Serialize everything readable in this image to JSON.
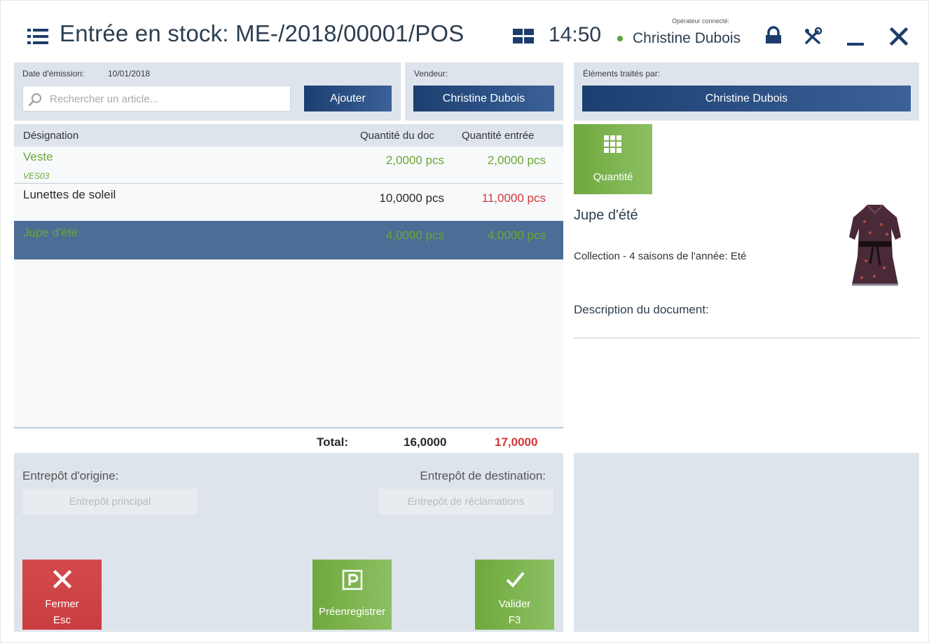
{
  "header": {
    "title": "Entrée en stock: ME-/2018/00001/POS",
    "time": "14:50",
    "operator_label": "Opérateur connecté:",
    "operator_name": "Christine Dubois"
  },
  "document": {
    "issue_date_label": "Date d'émission:",
    "issue_date": "10/01/2018",
    "search_placeholder": "Rechercher un article...",
    "add_label": "Ajouter",
    "seller_label": "Vendeur:",
    "seller_name": "Christine Dubois",
    "handled_by_label": "Éléments traités par:",
    "handled_by_name": "Christine Dubois"
  },
  "table": {
    "headers": [
      "Désignation",
      "Quantité du doc",
      "Quantité entrée"
    ],
    "rows": [
      {
        "name": "Veste",
        "code": "VES03",
        "qty_doc": "2,0000 pcs",
        "qty_in": "2,0000 pcs",
        "selected": false
      },
      {
        "name": "Lunettes de soleil",
        "code": "",
        "qty_doc": "10,0000 pcs",
        "qty_in": "11,0000 pcs",
        "selected": false
      },
      {
        "name": "Jupe d'été",
        "code": "",
        "qty_doc": "4,0000 pcs",
        "qty_in": "4,0000 pcs",
        "selected": true
      }
    ],
    "total_label": "Total:",
    "total_doc": "16,0000",
    "total_in": "17,0000"
  },
  "warehouses": {
    "origin_label": "Entrepôt d'origine:",
    "origin_value": "Entrepôt principal",
    "dest_label": "Entrepôt de destination:",
    "dest_value": "Entrepôt de réclamations"
  },
  "actions": {
    "close_label": "Fermer",
    "close_key": "Esc",
    "preregister_label": "Préenregistrer",
    "validate_label": "Valider",
    "validate_key": "F3"
  },
  "details": {
    "quantity_button": "Quantité",
    "product_name": "Jupe d'été",
    "collection": "Collection - 4 saisons de l'année: Eté",
    "description_label": "Description du document:"
  },
  "colors": {
    "accent_blue": "#2a4f85",
    "green": "#69a832",
    "red": "#d3373a",
    "panel": "#dee4ec",
    "selected_row": "#4c6d96"
  }
}
